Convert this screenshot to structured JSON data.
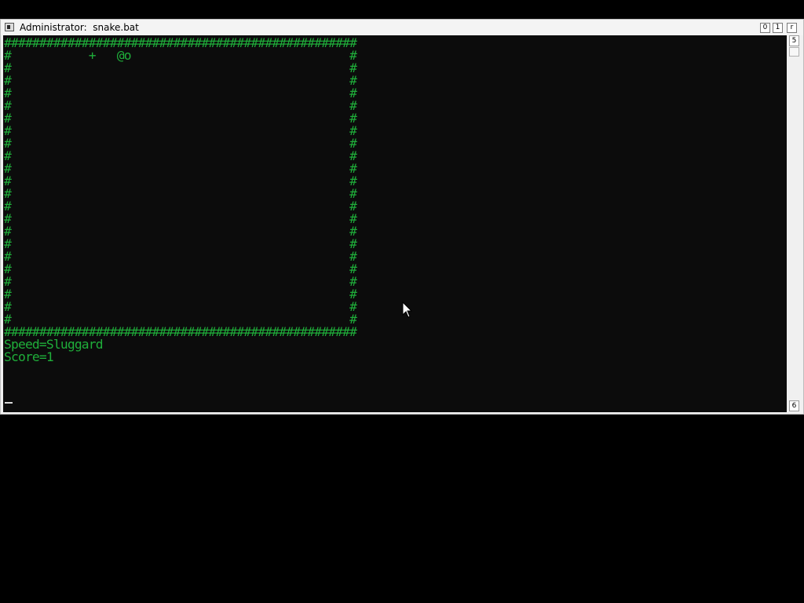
{
  "window": {
    "title": "Administrator:  snake.bat",
    "buttons": {
      "minimize": "0",
      "maximize": "1",
      "close": "r"
    }
  },
  "scrollbar": {
    "up_glyph": "5",
    "down_glyph": "6"
  },
  "console": {
    "text_color": "#1fae3a",
    "background": "#0c0c0c",
    "lines": [
      "##################################################",
      "#           +   @o                               #",
      "#                                                #",
      "#                                                #",
      "#                                                #",
      "#                                                #",
      "#                                                #",
      "#                                                #",
      "#                                                #",
      "#                                                #",
      "#                                                #",
      "#                                                #",
      "#                                                #",
      "#                                                #",
      "#                                                #",
      "#                                                #",
      "#                                                #",
      "#                                                #",
      "#                                                #",
      "#                                                #",
      "#                                                #",
      "#                                                #",
      "#                                                #",
      "##################################################",
      "Speed=Sluggard",
      "Score=1"
    ]
  }
}
